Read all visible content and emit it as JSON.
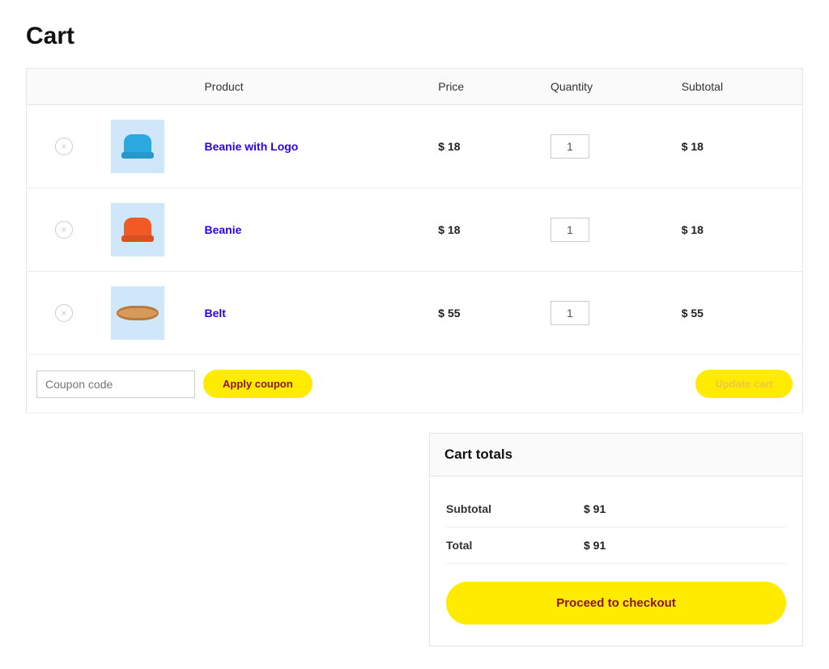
{
  "page": {
    "title": "Cart"
  },
  "table": {
    "headers": {
      "product": "Product",
      "price": "Price",
      "quantity": "Quantity",
      "subtotal": "Subtotal"
    },
    "items": [
      {
        "name": "Beanie with Logo",
        "price": "$ 18",
        "qty": "1",
        "subtotal": "$ 18",
        "thumb": "beanie-blue"
      },
      {
        "name": "Beanie",
        "price": "$ 18",
        "qty": "1",
        "subtotal": "$ 18",
        "thumb": "beanie-orange"
      },
      {
        "name": "Belt",
        "price": "$ 55",
        "qty": "1",
        "subtotal": "$ 55",
        "thumb": "belt"
      }
    ]
  },
  "coupon": {
    "placeholder": "Coupon code",
    "apply_label": "Apply coupon"
  },
  "update_label": "Update cart",
  "totals": {
    "heading": "Cart totals",
    "subtotal_label": "Subtotal",
    "subtotal_value": "$ 91",
    "total_label": "Total",
    "total_value": "$ 91",
    "checkout_label": "Proceed to checkout"
  }
}
